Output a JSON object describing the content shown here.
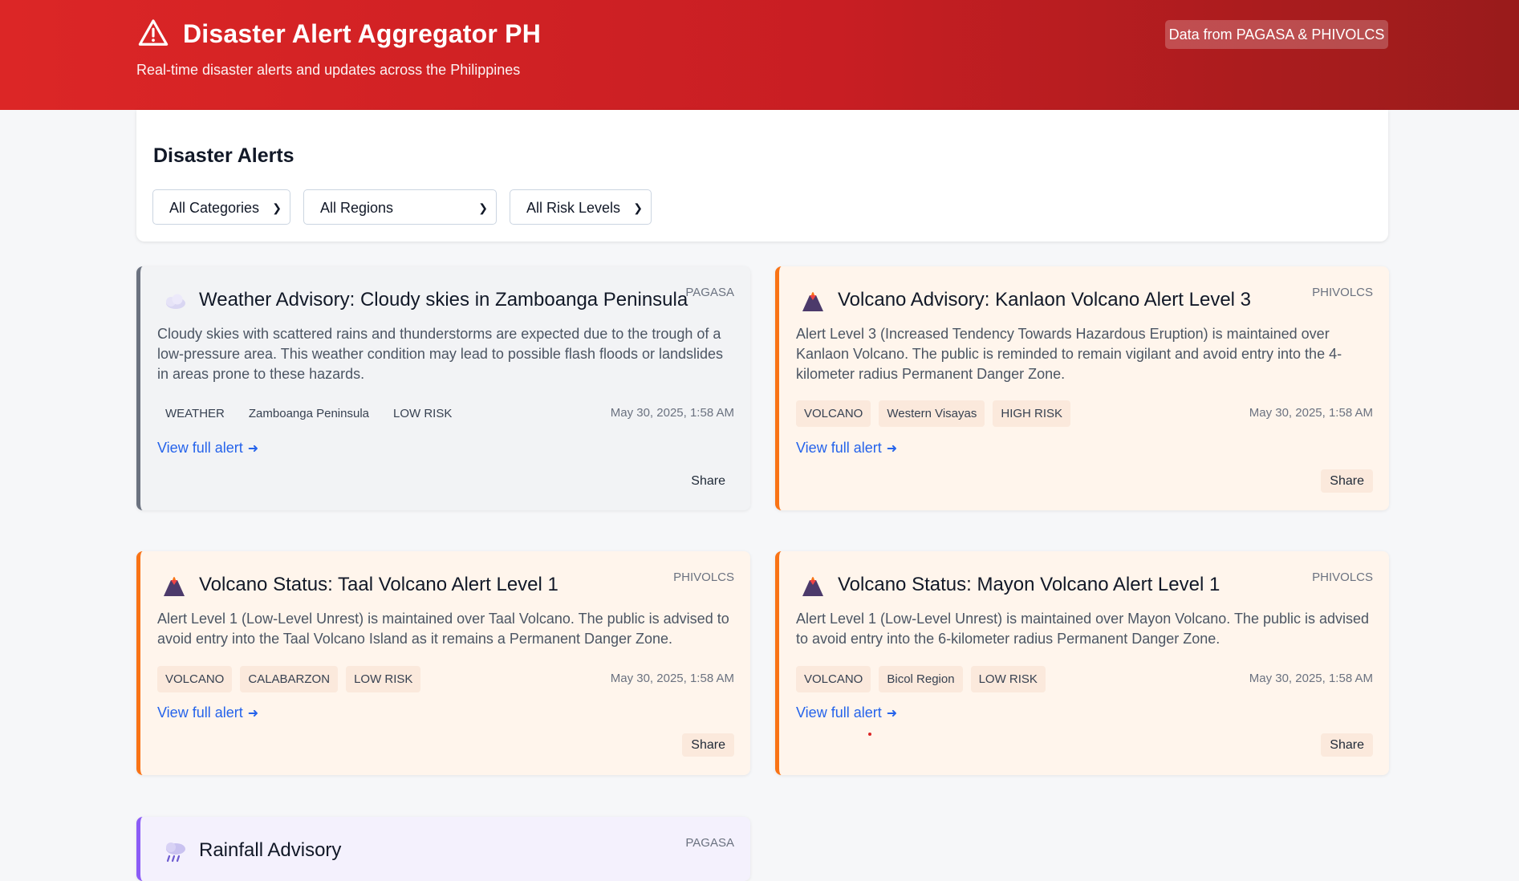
{
  "header": {
    "title": "Disaster Alert Aggregator PH",
    "subtitle": "Real-time disaster alerts and updates across the Philippines",
    "source_badge": "Data from PAGASA & PHIVOLCS",
    "icon": "warning-triangle-icon",
    "bg_colors": [
      "#dc2626",
      "#991b1b"
    ]
  },
  "filters": {
    "heading": "Disaster Alerts",
    "category": "All Categories",
    "region": "All Regions",
    "risk": "All Risk Levels"
  },
  "alerts": [
    {
      "title": "Weather Advisory: Cloudy skies in Zamboanga Peninsula",
      "source": "PAGASA",
      "icon": "cloud-icon",
      "description": "Cloudy skies with scattered rains and thunderstorms are expected due to the trough of a low-pressure area. This weather condition may lead to possible flash floods or landslides in areas prone to these hazards.",
      "category": "WEATHER",
      "region": "Zamboanga Peninsula",
      "risk": "LOW RISK",
      "date": "May 30, 2025, 1:58 AM",
      "link": "View full alert",
      "share": "Share",
      "accent": "#6b7280"
    },
    {
      "title": "Volcano Advisory: Kanlaon Volcano Alert Level 3",
      "source": "PHIVOLCS",
      "icon": "volcano-icon",
      "description": "Alert Level 3 (Increased Tendency Towards Hazardous Eruption) is maintained over Kanlaon Volcano. The public is reminded to remain vigilant and avoid entry into the 4-kilometer radius Permanent Danger Zone.",
      "category": "VOLCANO",
      "region": "Western Visayas",
      "risk": "HIGH RISK",
      "date": "May 30, 2025, 1:58 AM",
      "link": "View full alert",
      "share": "Share",
      "accent": "#f97316"
    },
    {
      "title": "Volcano Status: Taal Volcano Alert Level 1",
      "source": "PHIVOLCS",
      "icon": "volcano-icon",
      "description": "Alert Level 1 (Low-Level Unrest) is maintained over Taal Volcano. The public is advised to avoid entry into the Taal Volcano Island as it remains a Permanent Danger Zone.",
      "category": "VOLCANO",
      "region": "CALABARZON",
      "risk": "LOW RISK",
      "date": "May 30, 2025, 1:58 AM",
      "link": "View full alert",
      "share": "Share",
      "accent": "#f97316"
    },
    {
      "title": "Volcano Status: Mayon Volcano Alert Level 1",
      "source": "PHIVOLCS",
      "icon": "volcano-icon",
      "description": "Alert Level 1 (Low-Level Unrest) is maintained over Mayon Volcano. The public is advised to avoid entry into the 6-kilometer radius Permanent Danger Zone.",
      "category": "VOLCANO",
      "region": "Bicol Region",
      "risk": "LOW RISK",
      "date": "May 30, 2025, 1:58 AM",
      "link": "View full alert",
      "share": "Share",
      "accent": "#f97316"
    },
    {
      "title": "Rainfall Advisory",
      "source": "PAGASA",
      "icon": "rain-cloud-icon",
      "accent": "#8b5cf6"
    }
  ]
}
